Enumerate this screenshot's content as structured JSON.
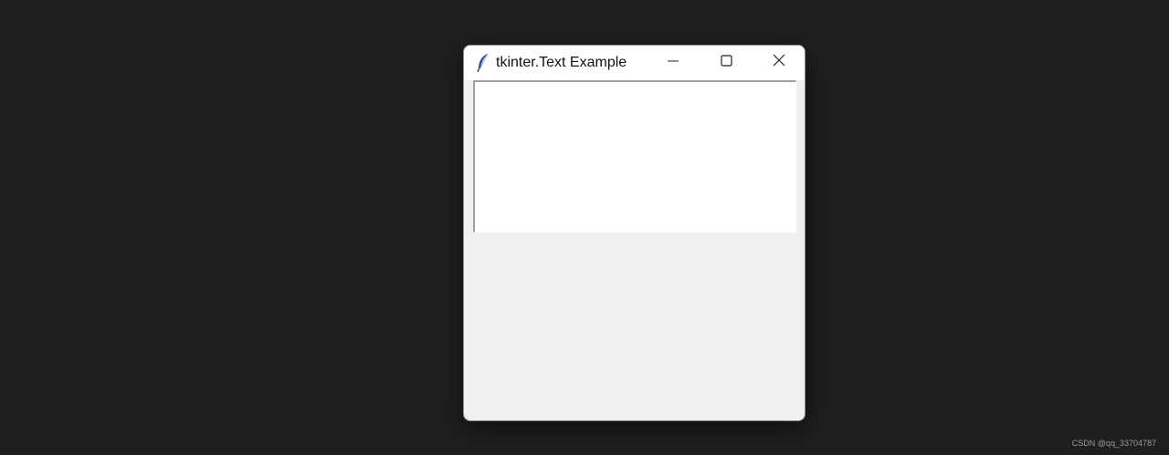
{
  "window": {
    "title": "tkinter.Text Example",
    "app_icon": "tk-feather-icon",
    "controls": {
      "minimize_icon": "minimize-icon",
      "maximize_icon": "maximize-icon",
      "close_icon": "close-icon"
    }
  },
  "text_widget": {
    "content": ""
  },
  "watermark": {
    "text": "CSDN @qq_33704787"
  },
  "colors": {
    "desktop_background": "#1f1f1f",
    "window_body": "#f0f0f0",
    "titlebar": "#ffffff",
    "text_area": "#ffffff"
  }
}
